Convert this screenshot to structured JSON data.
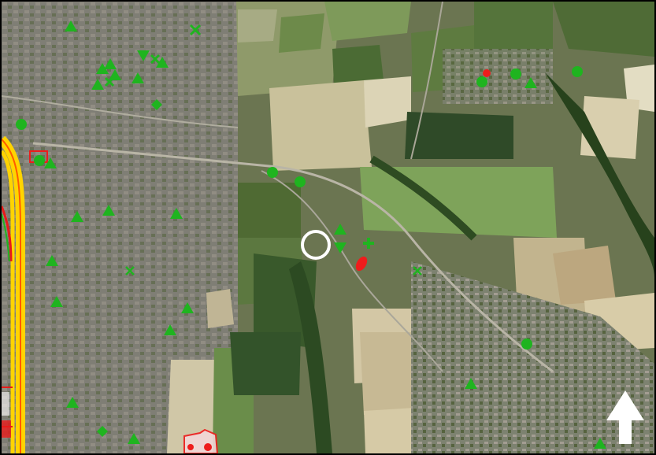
{
  "map": {
    "view": "satellite",
    "north_arrow": "north-arrow-icon"
  },
  "legend_colors": {
    "green_marker": "#1fb41f",
    "red_marker": "#ee1c1c",
    "highway": "#ffd400",
    "location_ring": "#ffffff"
  },
  "markers": [
    {
      "kind": "triangle",
      "color": "green"
    },
    {
      "kind": "triangle",
      "color": "green"
    },
    {
      "kind": "triangle",
      "color": "green"
    },
    {
      "kind": "triangle",
      "color": "green"
    },
    {
      "kind": "triangle",
      "color": "green"
    },
    {
      "kind": "triangle",
      "color": "green"
    },
    {
      "kind": "triangle",
      "color": "green"
    },
    {
      "kind": "triangle",
      "color": "green"
    },
    {
      "kind": "triangle",
      "color": "green"
    },
    {
      "kind": "triangle",
      "color": "green"
    },
    {
      "kind": "triangle",
      "color": "green"
    },
    {
      "kind": "triangle",
      "color": "green"
    },
    {
      "kind": "triangle",
      "color": "green"
    },
    {
      "kind": "triangle",
      "color": "green"
    },
    {
      "kind": "triangle",
      "color": "green"
    },
    {
      "kind": "triangle",
      "color": "green"
    },
    {
      "kind": "triangle",
      "color": "green"
    },
    {
      "kind": "triangle",
      "color": "green"
    },
    {
      "kind": "triangle",
      "color": "green"
    },
    {
      "kind": "triangle",
      "color": "green"
    },
    {
      "kind": "triangle-down",
      "color": "green"
    },
    {
      "kind": "triangle-down",
      "color": "green"
    },
    {
      "kind": "circle",
      "color": "green"
    },
    {
      "kind": "circle",
      "color": "green"
    },
    {
      "kind": "circle",
      "color": "green"
    },
    {
      "kind": "circle",
      "color": "green"
    },
    {
      "kind": "circle",
      "color": "green"
    },
    {
      "kind": "circle",
      "color": "green"
    },
    {
      "kind": "circle",
      "color": "green"
    },
    {
      "kind": "circle",
      "color": "green"
    },
    {
      "kind": "circle",
      "color": "red"
    },
    {
      "kind": "diamond",
      "color": "green"
    },
    {
      "kind": "diamond",
      "color": "green"
    },
    {
      "kind": "cross",
      "color": "green"
    },
    {
      "kind": "cross",
      "color": "green"
    },
    {
      "kind": "cross",
      "color": "green"
    },
    {
      "kind": "cross",
      "color": "green"
    },
    {
      "kind": "cross",
      "color": "green"
    },
    {
      "kind": "plus",
      "color": "green"
    },
    {
      "kind": "pin",
      "color": "red"
    },
    {
      "kind": "ring",
      "color": "white"
    }
  ]
}
